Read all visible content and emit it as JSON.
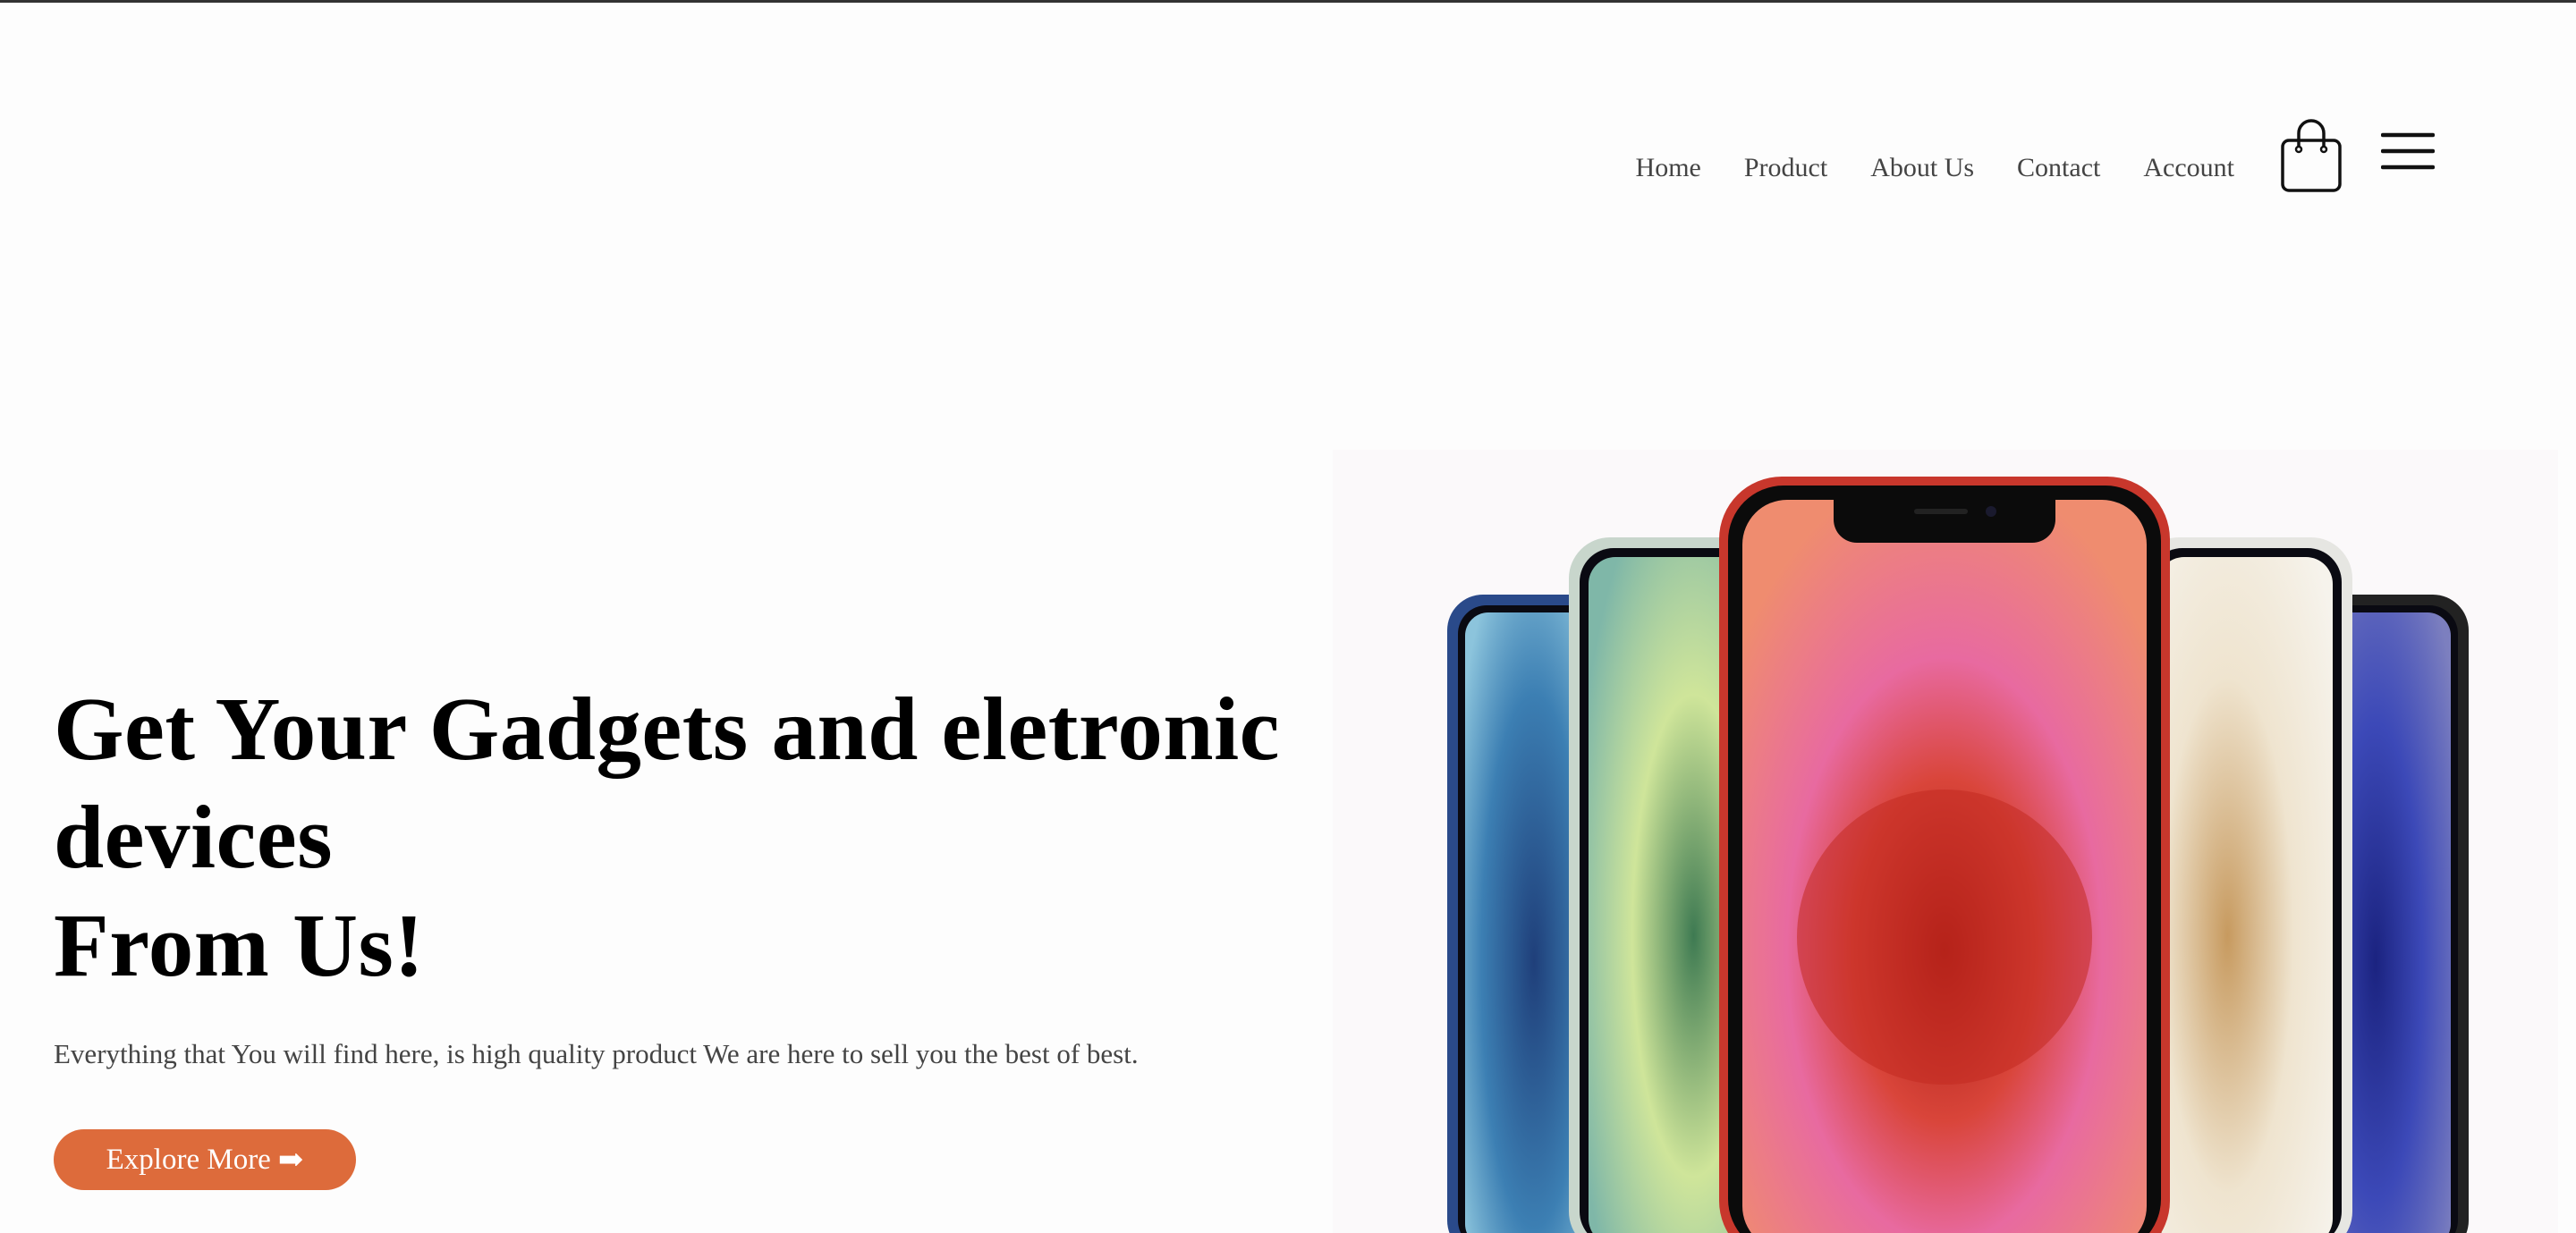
{
  "nav": {
    "items": [
      {
        "label": "Home"
      },
      {
        "label": "Product"
      },
      {
        "label": "About Us"
      },
      {
        "label": "Contact"
      },
      {
        "label": "Account"
      }
    ],
    "cart_icon": "shopping-bag-icon",
    "menu_icon": "hamburger-menu-icon"
  },
  "hero": {
    "title_line1": "Get Your Gadgets and eletronic devices",
    "title_line2": "From Us!",
    "subtitle": "Everything that You will find here, is high quality product We are here to sell you the best of best.",
    "button_label": "Explore More",
    "button_icon": "arrow-right-icon",
    "image_subject": "colorful smartphones fanned out"
  },
  "colors": {
    "accent": "#dd6b3b",
    "background": "#fdfdfd",
    "nav_text": "#444444",
    "title_text": "#000000"
  }
}
